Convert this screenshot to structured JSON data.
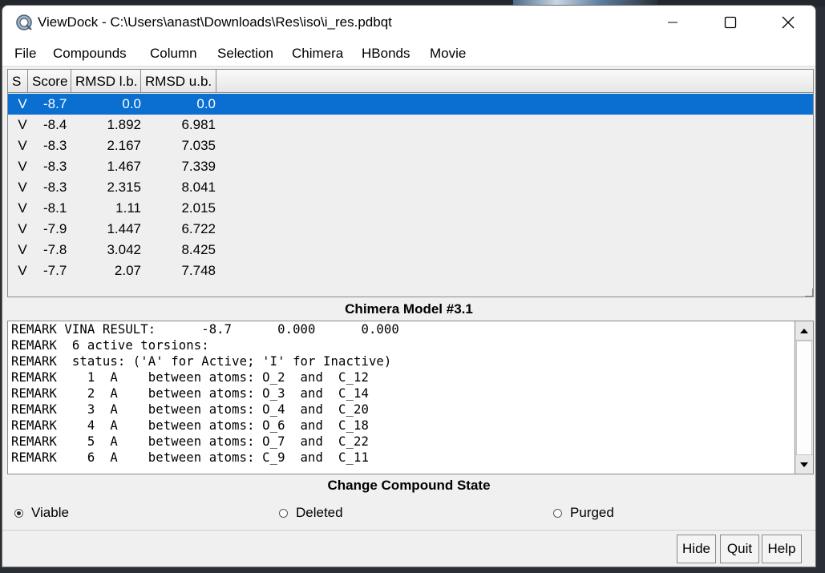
{
  "window": {
    "title": "ViewDock - C:\\Users\\anast\\Downloads\\Res\\iso\\i_res.pdbqt",
    "minimize_glyph": "—",
    "maximize_glyph": "☐",
    "close_glyph": "✕"
  },
  "menu": [
    "File",
    "Compounds",
    "Column",
    "Selection",
    "Chimera",
    "HBonds",
    "Movie"
  ],
  "table": {
    "headers": [
      "S",
      "Score",
      "RMSD l.b.",
      "RMSD u.b."
    ],
    "rows": [
      {
        "s": "V",
        "score": "-8.7",
        "lb": "0.0",
        "ub": "0.0",
        "selected": true
      },
      {
        "s": "V",
        "score": "-8.4",
        "lb": "1.892",
        "ub": "6.981"
      },
      {
        "s": "V",
        "score": "-8.3",
        "lb": "2.167",
        "ub": "7.035"
      },
      {
        "s": "V",
        "score": "-8.3",
        "lb": "1.467",
        "ub": "7.339"
      },
      {
        "s": "V",
        "score": "-8.3",
        "lb": "2.315",
        "ub": "8.041"
      },
      {
        "s": "V",
        "score": "-8.1",
        "lb": "1.11",
        "ub": "2.015"
      },
      {
        "s": "V",
        "score": "-7.9",
        "lb": "1.447",
        "ub": "6.722"
      },
      {
        "s": "V",
        "score": "-7.8",
        "lb": "3.042",
        "ub": "8.425"
      },
      {
        "s": "V",
        "score": "-7.7",
        "lb": "2.07",
        "ub": "7.748"
      }
    ]
  },
  "model_title": "Chimera Model #3.1",
  "remarks": [
    "REMARK VINA RESULT:      -8.7      0.000      0.000",
    "REMARK  6 active torsions:",
    "REMARK  status: ('A' for Active; 'I' for Inactive)",
    "REMARK    1  A    between atoms: O_2  and  C_12",
    "REMARK    2  A    between atoms: O_3  and  C_14",
    "REMARK    3  A    between atoms: O_4  and  C_20",
    "REMARK    4  A    between atoms: O_6  and  C_18",
    "REMARK    5  A    between atoms: O_7  and  C_22",
    "REMARK    6  A    between atoms: C_9  and  C_11"
  ],
  "state": {
    "title": "Change Compound State",
    "options": [
      {
        "label": "Viable",
        "checked": true
      },
      {
        "label": "Deleted",
        "checked": false
      },
      {
        "label": "Purged",
        "checked": false
      }
    ]
  },
  "buttons": {
    "hide": "Hide",
    "quit": "Quit",
    "help": "Help"
  },
  "colors": {
    "selection": "#0a6fd0",
    "window_bg": "#f0f0f0"
  },
  "icons": [
    "app-icon",
    "minimize-icon",
    "maximize-icon",
    "close-icon",
    "scroll-up-icon",
    "scroll-down-icon"
  ]
}
